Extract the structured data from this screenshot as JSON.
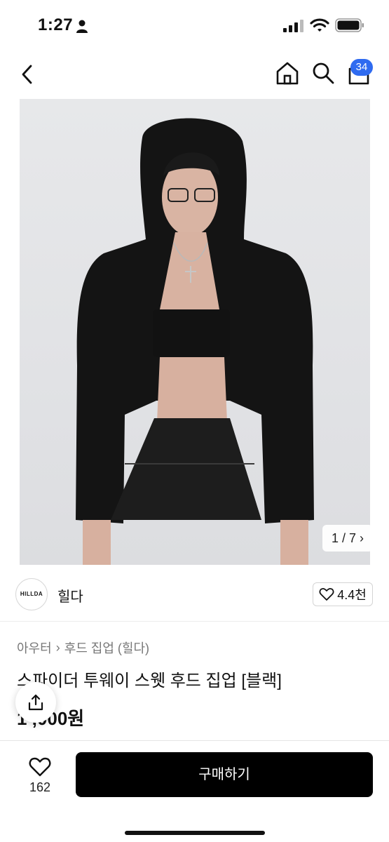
{
  "status_bar": {
    "time": "1:27",
    "icons": [
      "person-icon",
      "signal-icon",
      "wifi-icon",
      "battery-icon"
    ]
  },
  "nav": {
    "icons": [
      "chevron-left-icon",
      "home-icon",
      "search-icon",
      "shopping-bag-icon"
    ],
    "cart_count": "34",
    "badge_color": "#2f6bf0"
  },
  "gallery": {
    "counter": "1 / 7",
    "counter_icon": "chevron-right-icon"
  },
  "shop": {
    "logo_text": "HILLDA",
    "name": "힐다",
    "like_count": "4.4천",
    "like_icon": "heart-outline-icon"
  },
  "product": {
    "breadcrumb": [
      "아우터",
      "후드 집업 (힐다)"
    ],
    "title": "스파이더 투웨이 스웻 후드 집업 [블랙]",
    "price": "1 ,000원"
  },
  "bottom_bar": {
    "wish_count": "162",
    "buy_label": "구매하기",
    "buy_color": "#000000"
  }
}
